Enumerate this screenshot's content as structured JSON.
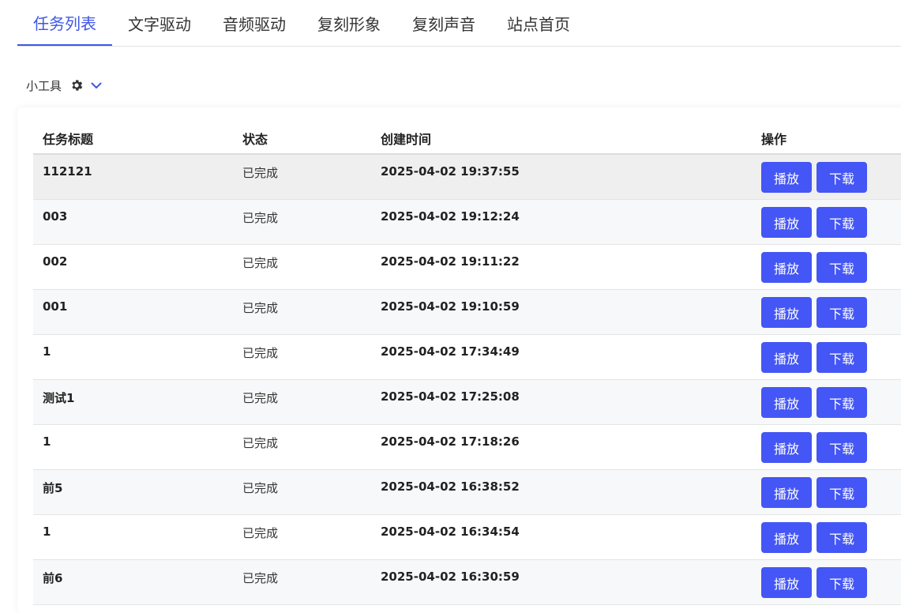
{
  "tabs": [
    {
      "label": "任务列表",
      "active": true
    },
    {
      "label": "文字驱动",
      "active": false
    },
    {
      "label": "音频驱动",
      "active": false
    },
    {
      "label": "复刻形象",
      "active": false
    },
    {
      "label": "复刻声音",
      "active": false
    },
    {
      "label": "站点首页",
      "active": false
    }
  ],
  "toolbar": {
    "label": "小工具",
    "icons": [
      "gear-icon",
      "chevron-down-icon"
    ]
  },
  "table": {
    "headers": {
      "title": "任务标题",
      "status": "状态",
      "created": "创建时间",
      "actions": "操作"
    },
    "play_label": "播放",
    "download_label": "下载",
    "rows": [
      {
        "title": "112121",
        "status": "已完成",
        "created": "2025-04-02 19:37:55"
      },
      {
        "title": "003",
        "status": "已完成",
        "created": "2025-04-02 19:12:24"
      },
      {
        "title": "002",
        "status": "已完成",
        "created": "2025-04-02 19:11:22"
      },
      {
        "title": "001",
        "status": "已完成",
        "created": "2025-04-02 19:10:59"
      },
      {
        "title": "1",
        "status": "已完成",
        "created": "2025-04-02 17:34:49"
      },
      {
        "title": "测试1",
        "status": "已完成",
        "created": "2025-04-02 17:25:08"
      },
      {
        "title": "1",
        "status": "已完成",
        "created": "2025-04-02 17:18:26"
      },
      {
        "title": "前5",
        "status": "已完成",
        "created": "2025-04-02 16:38:52"
      },
      {
        "title": "1",
        "status": "已完成",
        "created": "2025-04-02 16:34:54"
      },
      {
        "title": "前6",
        "status": "已完成",
        "created": "2025-04-02 16:30:59"
      }
    ]
  },
  "colors": {
    "accent": "#3e57e6",
    "button": "#4456f5"
  }
}
